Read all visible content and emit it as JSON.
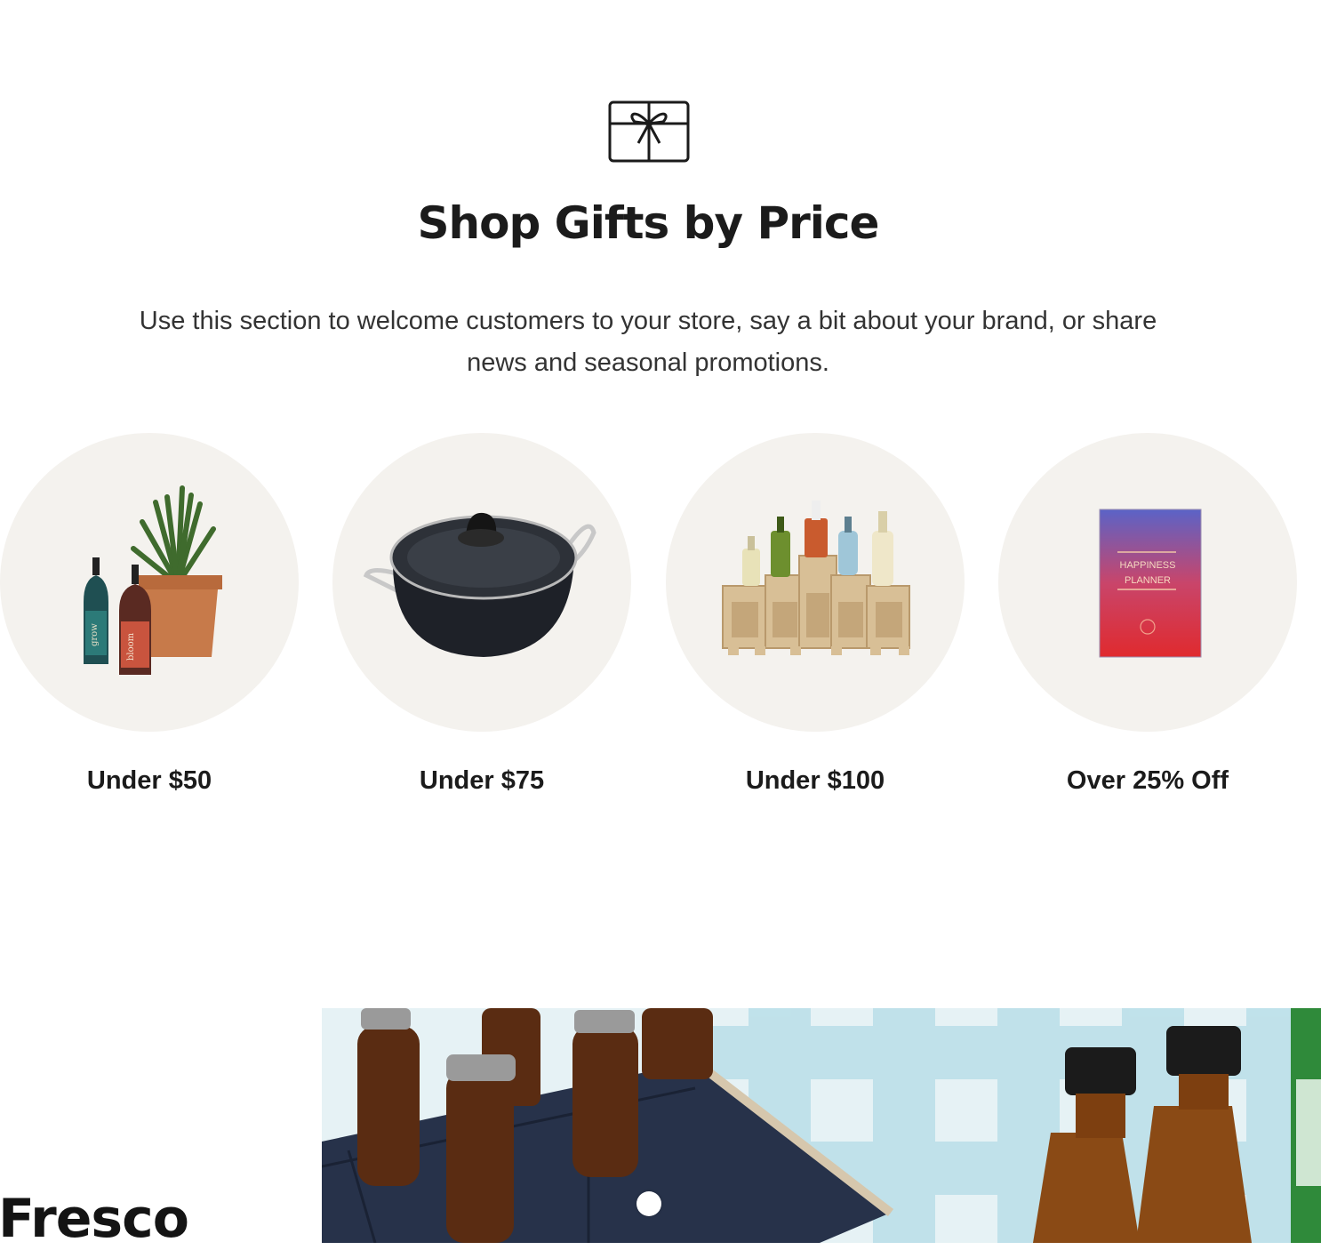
{
  "section": {
    "icon": "gift-card-icon",
    "title": "Shop Gifts by Price",
    "description": "Use this section to welcome customers to your store, say a bit about your brand, or share news and seasonal promotions."
  },
  "categories": [
    {
      "label": "Under $50",
      "image": "dropper-bottles-and-plant-image",
      "bottle_labels": [
        "grow",
        "bloom"
      ]
    },
    {
      "label": "Under $75",
      "image": "cooking-pot-image"
    },
    {
      "label": "Under $100",
      "image": "liquor-bottles-on-wooden-stand-image"
    },
    {
      "label": "Over 25% Off",
      "image": "happiness-planner-book-image",
      "book_title": "HAPPINESS PLANNER"
    }
  ],
  "slideshow": {
    "heading": "Fresco",
    "image": "beer-bottles-in-cooler-bag-image",
    "active_slide": 1
  },
  "colors": {
    "circle_bg": "#f4f2ee",
    "text": "#1b1b1b"
  }
}
